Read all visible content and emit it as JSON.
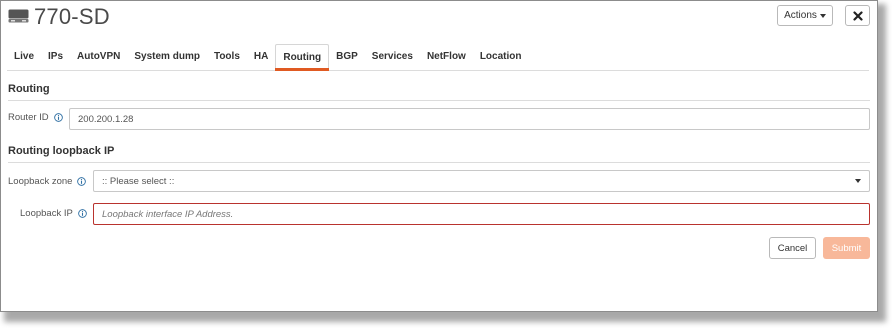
{
  "header": {
    "device_icon": "network-appliance-icon",
    "title": "770-SD",
    "actions_label": "Actions",
    "close_icon": "close-icon"
  },
  "tabs": [
    {
      "label": "Live",
      "active": false
    },
    {
      "label": "IPs",
      "active": false
    },
    {
      "label": "AutoVPN",
      "active": false
    },
    {
      "label": "System dump",
      "active": false
    },
    {
      "label": "Tools",
      "active": false
    },
    {
      "label": "HA",
      "active": false
    },
    {
      "label": "Routing",
      "active": true
    },
    {
      "label": "BGP",
      "active": false
    },
    {
      "label": "Services",
      "active": false
    },
    {
      "label": "NetFlow",
      "active": false
    },
    {
      "label": "Location",
      "active": false
    }
  ],
  "routing": {
    "section_title": "Routing",
    "router_id_label": "Router ID",
    "router_id_value": "200.200.1.28"
  },
  "loopback": {
    "section_title": "Routing loopback IP",
    "zone_label": "Loopback zone",
    "zone_selected": ":: Please select ::",
    "ip_label": "Loopback IP",
    "ip_placeholder": "Loopback interface IP Address.",
    "ip_value": ""
  },
  "footer": {
    "cancel_label": "Cancel",
    "submit_label": "Submit"
  },
  "colors": {
    "accent": "#e05a22",
    "submit_disabled": "#f8b89a",
    "error_border": "#b9332e",
    "info_icon": "#2f6fa3"
  }
}
